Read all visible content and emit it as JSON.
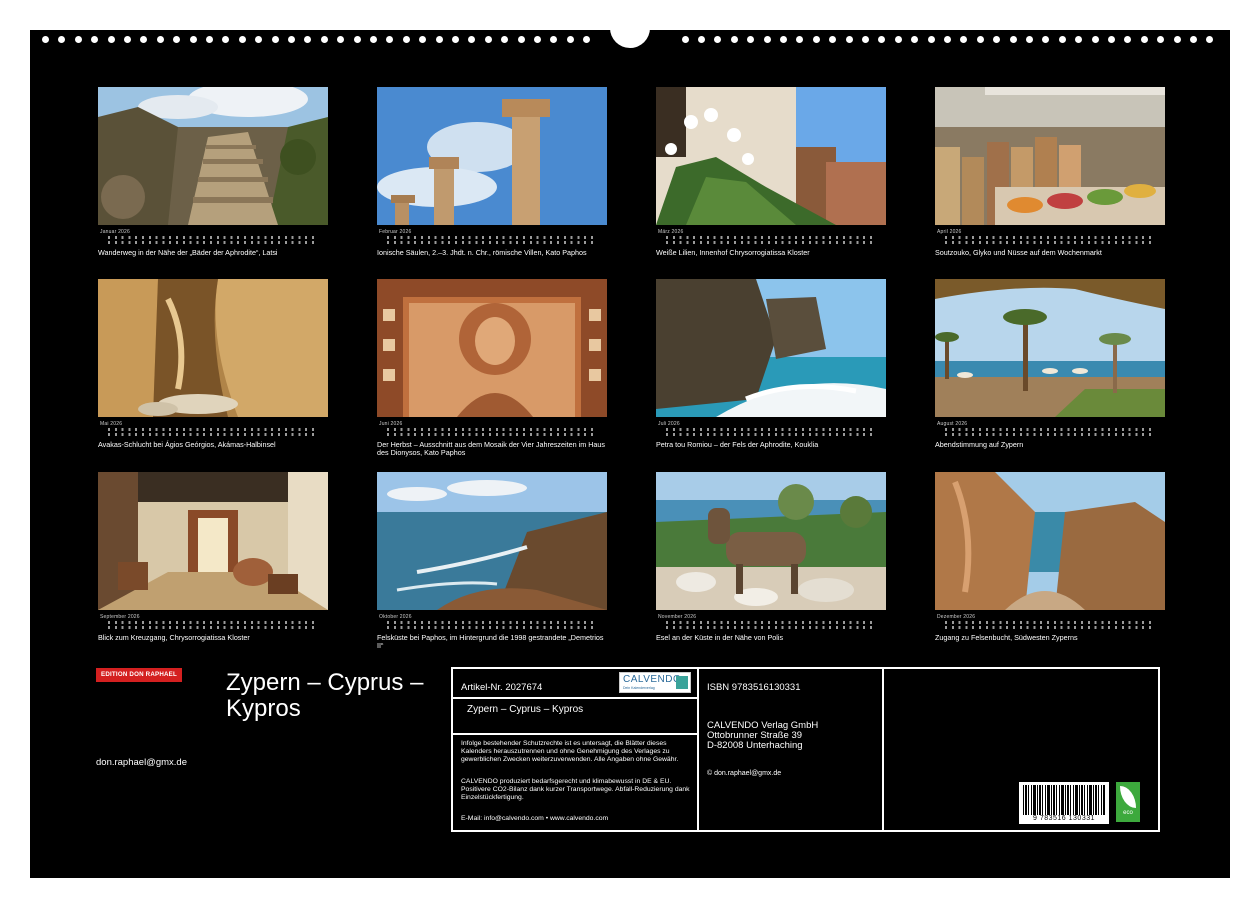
{
  "months": [
    {
      "name": "Januar 2026",
      "caption": "Wanderweg in der Nähe der „Bäder der Aphrodite“, Latsi"
    },
    {
      "name": "Februar 2026",
      "caption": "Ionische Säulen, 2.–3. Jhdt. n. Chr., römische Villen, Kato Paphos"
    },
    {
      "name": "März 2026",
      "caption": "Weiße Lilien, Innenhof Chrysorrogiatissa Kloster"
    },
    {
      "name": "April 2026",
      "caption": "Soutzouko, Glyko und Nüsse auf dem Wochenmarkt"
    },
    {
      "name": "Mai 2026",
      "caption": "Avakas-Schlucht bei Ágios Geórgios, Akámas-Halbinsel"
    },
    {
      "name": "Juni 2026",
      "caption": "Der Herbst – Ausschnitt aus dem Mosaik der Vier Jahreszeiten im Haus des Dionysos, Kato Paphos"
    },
    {
      "name": "Juli 2026",
      "caption": "Petra tou Romiou – der Fels der Aphrodite, Kouklia"
    },
    {
      "name": "August 2026",
      "caption": "Abendstimmung auf Zypern"
    },
    {
      "name": "September 2026",
      "caption": "Blick zum Kreuzgang, Chrysorrogiatissa Kloster"
    },
    {
      "name": "Oktober 2026",
      "caption": "Felsküste bei Paphos, im Hintergrund die 1998 gestrandete „Demetrios II“"
    },
    {
      "name": "November 2026",
      "caption": "Esel an der Küste in der Nähe von Polis"
    },
    {
      "name": "Dezember 2026",
      "caption": "Zugang zu Felsenbucht, Südwesten Zyperns"
    }
  ],
  "brand": {
    "label": "EDITION DON RAPHAEL"
  },
  "title": "Zypern – Cyprus – Kypros",
  "author_email": "don.raphael@gmx.de",
  "info": {
    "article": "Artikel-Nr. 2027674",
    "subtitle": "Zypern – Cyprus – Kypros",
    "legal": "Infolge bestehender Schutzrechte ist es untersagt, die Blätter dieses Kalenders herauszutrennen und ohne Genehmigung des Verlages zu gewerblichen Zwecken weiterzuverwenden. Alle Angaben ohne Gewähr.",
    "climate": "CALVENDO produziert bedarfsgerecht und klimabewusst in DE & EU. Positivere CO2-Bilanz dank kurzer Transportwege. Abfall-Reduzierung dank Einzelstückfertigung.",
    "contact": "E-Mail: info@calvendo.com • www.calvendo.com",
    "logo_name": "CALVENDO",
    "logo_sub": "Dein Kalenderverlag",
    "isbn": "ISBN 9783516130331",
    "publisher": "CALVENDO Verlag GmbH",
    "street": "Ottobrunner Straße 39",
    "city": "D-82008 Unterhaching",
    "copyright": "© don.raphael@gmx.de",
    "barcode_digits": "9 783516 130331",
    "eco_label": "eco"
  }
}
